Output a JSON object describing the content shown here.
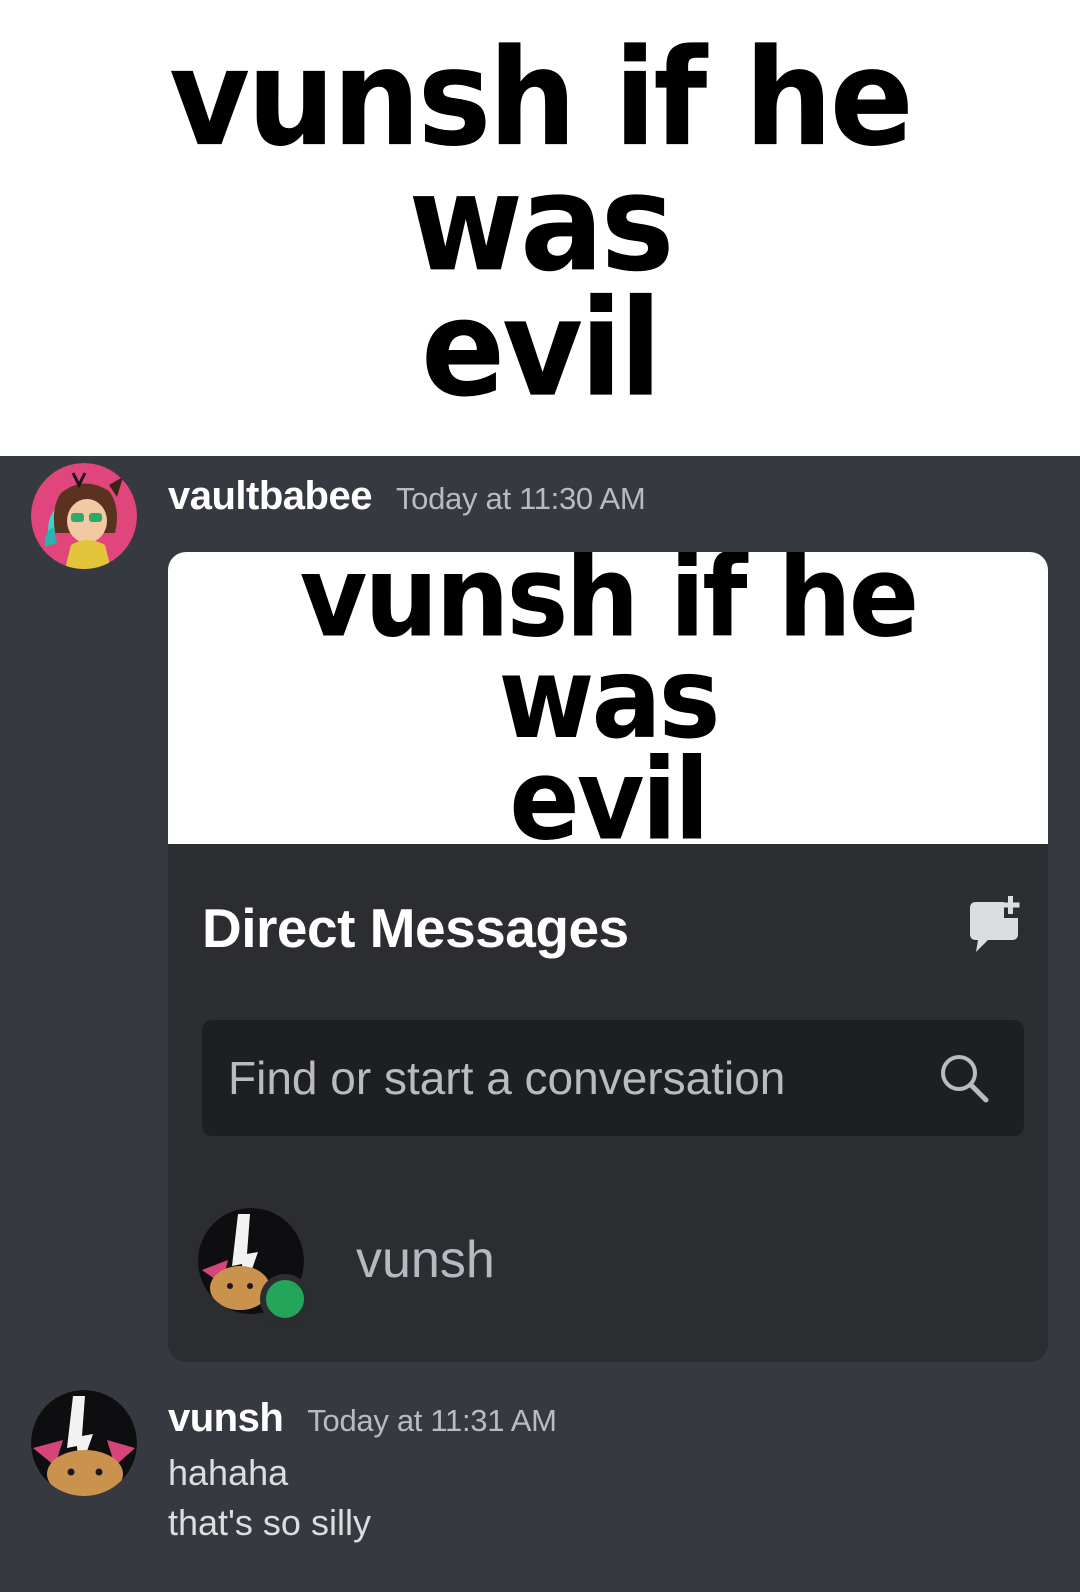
{
  "meme": {
    "caption_line1": "vunsh if he was",
    "caption_line2": "evil"
  },
  "messages": [
    {
      "username": "vaultbabee",
      "timestamp": "Today at 11:30 AM",
      "embed": {
        "caption_line1": "vunsh if he was",
        "caption_line2": "evil",
        "dm_title": "Direct Messages",
        "new_dm_icon": "new-group-dm-icon",
        "search": {
          "placeholder": "Find or start a conversation",
          "icon": "search-icon"
        },
        "dm_user": {
          "name": "vunsh",
          "status": "online",
          "status_color": "#23a55a"
        }
      }
    },
    {
      "username": "vunsh",
      "timestamp": "Today at 11:31 AM",
      "lines": [
        "hahaha",
        "that's so silly"
      ]
    }
  ],
  "colors": {
    "chat_background": "#36393f",
    "embed_background": "#2b2d31",
    "search_background": "#1e1f22",
    "vaultbabee_avatar_bg": "#e0457b"
  }
}
